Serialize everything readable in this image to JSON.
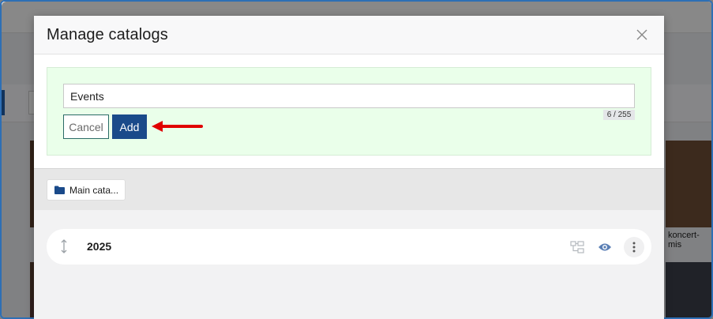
{
  "background": {
    "caption_right": "koncert-mis"
  },
  "modal": {
    "title": "Manage catalogs",
    "close_icon": "close-icon"
  },
  "form": {
    "input_value": "Events",
    "counter": "6 / 255",
    "cancel_label": "Cancel",
    "add_label": "Add",
    "form_bg_color": "#eaffea",
    "annotation_arrow_color": "#e00000"
  },
  "breadcrumb": {
    "label": "Main cata...",
    "icon": "folder-icon"
  },
  "catalogs": [
    {
      "label": "2025",
      "icons": [
        "drag-vertical-icon",
        "tree-structure-icon",
        "eye-icon",
        "more-vertical-icon"
      ]
    }
  ],
  "colors": {
    "primary": "#1a4a8a",
    "cancel_border": "#2a6b66",
    "eye_icon": "#5a7fb5"
  }
}
